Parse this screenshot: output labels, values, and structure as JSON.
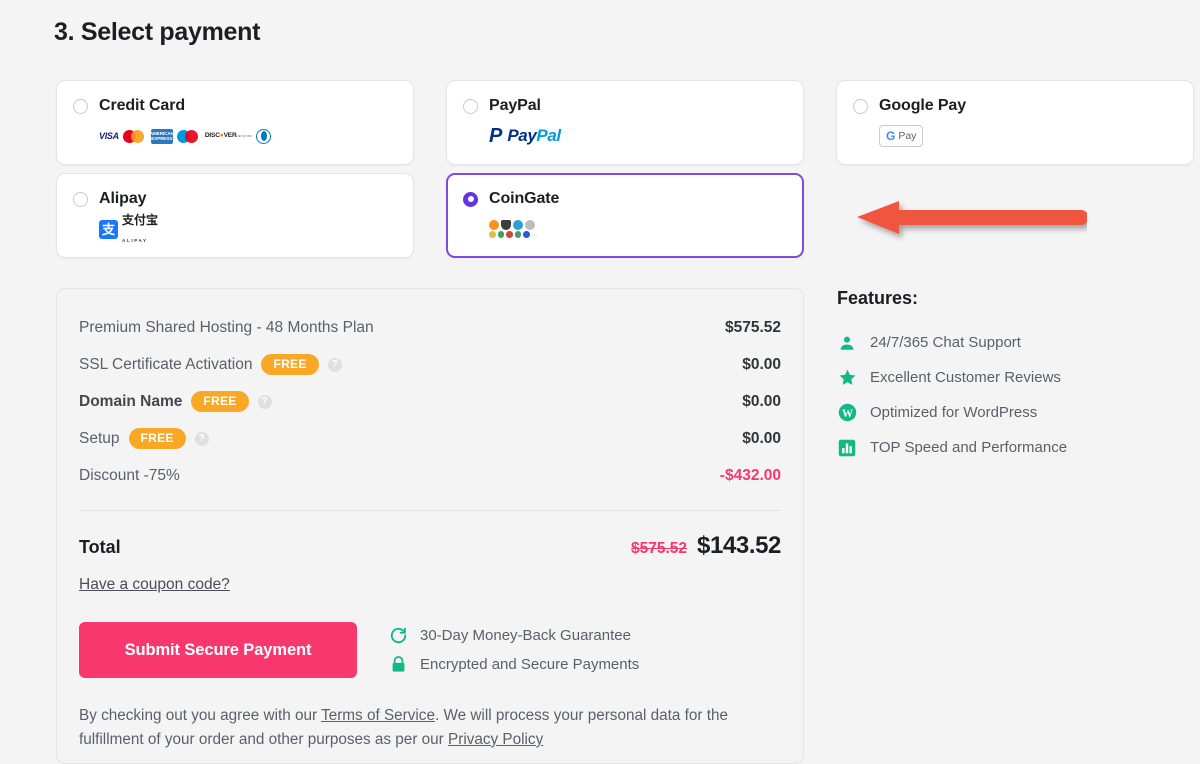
{
  "heading": "3. Select payment",
  "payment_methods": [
    {
      "id": "credit-card",
      "label": "Credit Card",
      "selected": false,
      "logos": [
        "visa",
        "mastercard",
        "amex",
        "maestro",
        "discover",
        "diners-club"
      ]
    },
    {
      "id": "paypal",
      "label": "PayPal",
      "selected": false,
      "logo_text_a": "Pay",
      "logo_text_b": "Pal",
      "logo_mark": "P"
    },
    {
      "id": "google-pay",
      "label": "Google Pay",
      "selected": false,
      "badge_g": "G",
      "badge_text": "Pay"
    },
    {
      "id": "alipay",
      "label": "Alipay",
      "selected": false,
      "mark": "支",
      "cn": "支付宝",
      "en": "ALIPAY"
    },
    {
      "id": "coingate",
      "label": "CoinGate",
      "selected": true,
      "coins_row1": [
        "bitcoin",
        "ethereum",
        "ripple",
        "litecoin"
      ],
      "coins_row2": [
        "bitcoin-cash",
        "dash",
        "tether",
        "monero",
        "eos",
        "more"
      ],
      "coins_more": "..."
    }
  ],
  "annotation": {
    "type": "arrow",
    "direction": "left",
    "color": "#f05540",
    "points_to": "coingate"
  },
  "summary": {
    "items": [
      {
        "name": "Premium Shared Hosting - 48 Months Plan",
        "badge": "",
        "help": false,
        "strong": false,
        "price": "$575.52",
        "negative": false
      },
      {
        "name": "SSL Certificate Activation",
        "badge": "FREE",
        "help": true,
        "strong": false,
        "price": "$0.00",
        "negative": false
      },
      {
        "name": "Domain Name",
        "badge": "FREE",
        "help": true,
        "strong": true,
        "price": "$0.00",
        "negative": false
      },
      {
        "name": "Setup",
        "badge": "FREE",
        "help": true,
        "strong": false,
        "price": "$0.00",
        "negative": false
      },
      {
        "name": "Discount -75%",
        "badge": "",
        "help": false,
        "strong": false,
        "price": "-$432.00",
        "negative": true
      }
    ],
    "total_label": "Total",
    "total_old": "$575.52",
    "total_new": "$143.52",
    "coupon_link": "Have a coupon code?",
    "submit_label": "Submit Secure Payment",
    "assurances": [
      {
        "icon": "refresh-icon",
        "text": "30-Day Money-Back Guarantee"
      },
      {
        "icon": "lock-icon",
        "text": "Encrypted and Secure Payments"
      }
    ],
    "legal": {
      "part1": "By checking out you agree with our ",
      "link1": "Terms of Service",
      "part2": ". We will process your personal data for the fulfillment of your order and other purposes as per our ",
      "link2": "Privacy Policy"
    }
  },
  "features": {
    "title": "Features:",
    "items": [
      {
        "icon": "person-icon",
        "text": "24/7/365 Chat Support"
      },
      {
        "icon": "star-icon",
        "text": "Excellent Customer Reviews"
      },
      {
        "icon": "wordpress-icon",
        "text": "Optimized for WordPress"
      },
      {
        "icon": "bar-chart-icon",
        "text": "TOP Speed and Performance"
      }
    ]
  },
  "colors": {
    "accent_pink": "#f8376f",
    "accent_purple": "#6633e0",
    "badge_orange": "#f9a825",
    "feature_green": "#13b888",
    "arrow_red": "#f05540"
  }
}
